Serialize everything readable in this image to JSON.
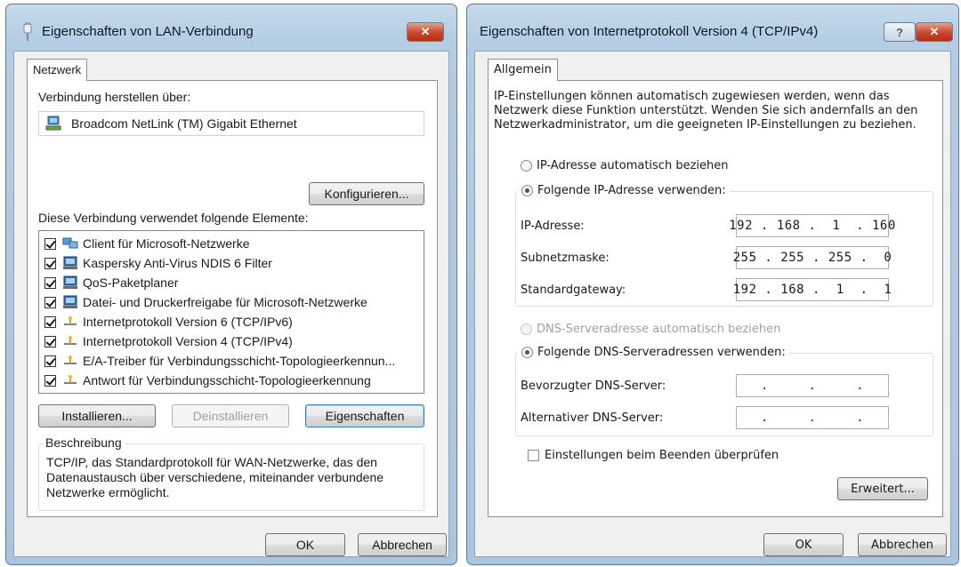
{
  "left_dialog": {
    "title": "Eigenschaften von LAN-Verbindung",
    "close_glyph": "✕",
    "tab": "Netzwerk",
    "connect_via_label": "Verbindung herstellen über:",
    "adapter_name": "Broadcom NetLink (TM) Gigabit Ethernet",
    "configure_button": "Konfigurieren...",
    "elements_label": "Diese Verbindung verwendet folgende Elemente:",
    "items": [
      {
        "label": "Client für Microsoft-Netzwerke",
        "checked": true,
        "icon": "network-client-icon"
      },
      {
        "label": "Kaspersky Anti-Virus NDIS 6 Filter",
        "checked": true,
        "icon": "service-icon"
      },
      {
        "label": "QoS-Paketplaner",
        "checked": true,
        "icon": "service-icon"
      },
      {
        "label": "Datei- und Druckerfreigabe für Microsoft-Netzwerke",
        "checked": true,
        "icon": "service-icon"
      },
      {
        "label": "Internetprotokoll Version 6 (TCP/IPv6)",
        "checked": true,
        "icon": "protocol-icon"
      },
      {
        "label": "Internetprotokoll Version 4 (TCP/IPv4)",
        "checked": true,
        "icon": "protocol-icon"
      },
      {
        "label": "E/A-Treiber für Verbindungsschicht-Topologieerkennun...",
        "checked": true,
        "icon": "protocol-icon"
      },
      {
        "label": "Antwort für Verbindungsschicht-Topologieerkennung",
        "checked": true,
        "icon": "protocol-icon"
      }
    ],
    "install_button": "Installieren...",
    "uninstall_button": "Deinstallieren",
    "properties_button": "Eigenschaften",
    "description_caption": "Beschreibung",
    "description_text": "TCP/IP, das Standardprotokoll für WAN-Netzwerke, das den Datenaustausch über verschiedene, miteinander verbundene Netzwerke ermöglicht.",
    "ok_button": "OK",
    "cancel_button": "Abbrechen"
  },
  "right_dialog": {
    "title": "Eigenschaften von Internetprotokoll Version 4 (TCP/IPv4)",
    "help_glyph": "?",
    "close_glyph": "✕",
    "tab": "Allgemein",
    "intro_text": "IP-Einstellungen können automatisch zugewiesen werden, wenn das Netzwerk diese Funktion unterstützt. Wenden Sie sich andernfalls an den Netzwerkadministrator, um die geeigneten IP-Einstellungen zu beziehen.",
    "radio_ip_auto": "IP-Adresse automatisch beziehen",
    "radio_ip_manual": "Folgende IP-Adresse verwenden:",
    "ip_label": "IP-Adresse:",
    "ip_value": "192 . 168 .  1  . 160",
    "subnet_label": "Subnetzmaske:",
    "subnet_value": "255 . 255 . 255 .  0",
    "gateway_label": "Standardgateway:",
    "gateway_value": "192 . 168 .  1  .  1",
    "radio_dns_auto": "DNS-Serveradresse automatisch beziehen",
    "radio_dns_manual": "Folgende DNS-Serveradressen verwenden:",
    "dns_preferred_label": "Bevorzugter DNS-Server:",
    "dns_preferred_value": "    .     .     .    ",
    "dns_alternate_label": "Alternativer DNS-Server:",
    "dns_alternate_value": "    .     .     .    ",
    "validate_checkbox": "Einstellungen beim Beenden überprüfen",
    "advanced_button": "Erweitert...",
    "ok_button": "OK",
    "cancel_button": "Abbrechen"
  }
}
